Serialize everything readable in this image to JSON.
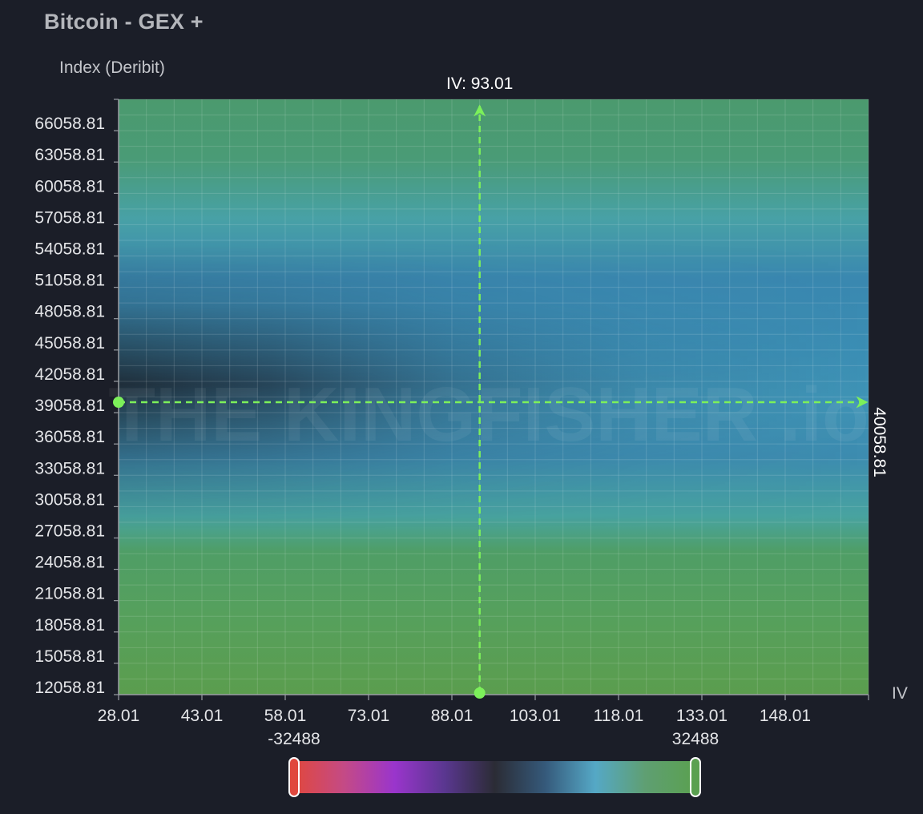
{
  "chart_data": {
    "type": "heatmap",
    "title": "Bitcoin - GEX +",
    "xlabel": "IV",
    "ylabel": "Index (Deribit)",
    "x_ticks": [
      "28.01",
      "43.01",
      "58.01",
      "73.01",
      "88.01",
      "103.01",
      "118.01",
      "133.01",
      "148.01"
    ],
    "y_ticks": [
      "12058.81",
      "15058.81",
      "18058.81",
      "21058.81",
      "24058.81",
      "27058.81",
      "30058.81",
      "33058.81",
      "36058.81",
      "39058.81",
      "42058.81",
      "45058.81",
      "48058.81",
      "51058.81",
      "54058.81",
      "57058.81",
      "60058.81",
      "63058.81",
      "66058.81"
    ],
    "xlim": [
      28.01,
      163.01
    ],
    "ylim": [
      12058.81,
      69058.81
    ],
    "grid": true,
    "crosshair": {
      "x": 93.01,
      "y": 40058.81,
      "x_label": "IV: 93.01",
      "y_label": "40058.81",
      "color": "#7cf05a"
    },
    "visual_map": {
      "min": -32488,
      "max": 32488,
      "min_label": "-32488",
      "max_label": "32488",
      "colors": [
        "#e0483e",
        "#c44a86",
        "#9a35cc",
        "#5a3790",
        "#2b2c35",
        "#35597a",
        "#55a8c6",
        "#5f9f72",
        "#5aa050"
      ]
    },
    "watermark": "THE KINGFISHER .io"
  }
}
